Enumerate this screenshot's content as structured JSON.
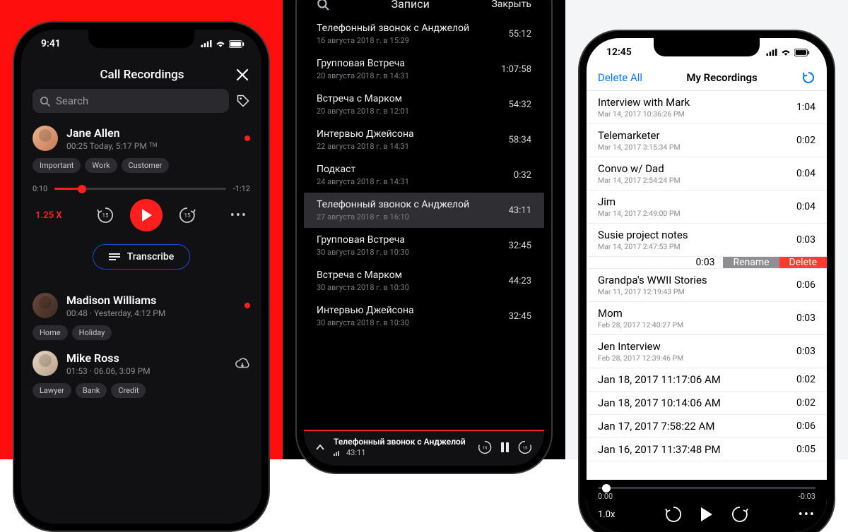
{
  "phone1": {
    "status_time": "9:41",
    "title": "Call Recordings",
    "search_placeholder": "Search",
    "slider": {
      "elapsed": "0:10",
      "remaining": "-1:12",
      "percent": 16
    },
    "speed": "1.25 X",
    "transcribe_label": "Transcribe",
    "items": [
      {
        "name": "Jane Allen",
        "meta": "00:25 Today, 5:17 PM ᵀᴹ",
        "tags": [
          "Important",
          "Work",
          "Customer"
        ],
        "unread": true
      },
      {
        "name": "Madison Williams",
        "meta": "00:48 · Yesterday, 4:12 PM",
        "tags": [
          "Home",
          "Holiday"
        ],
        "unread": true
      },
      {
        "name": "Mike Ross",
        "meta": "01:53 · 06.06, 3:09 PM",
        "tags": [
          "Lawyer",
          "Bank",
          "Credit"
        ],
        "unread": false,
        "cloud": true
      }
    ]
  },
  "phone2": {
    "header": {
      "title": "Записи",
      "close": "Закрыть"
    },
    "items": [
      {
        "name": "Телефонный звонок с Анджелой",
        "ts": "16 августа 2018 г. в 15:29",
        "dur": "55:12"
      },
      {
        "name": "Групповая Встреча",
        "ts": "20 августа 2018 г. в 14:31",
        "dur": "1:07:58"
      },
      {
        "name": "Встреча с Марком",
        "ts": "20 августа 2018 г. в 12:01",
        "dur": "54:32"
      },
      {
        "name": "Интервью Джейсона",
        "ts": "22 августа 2018 г. в 14:31",
        "dur": "58:34"
      },
      {
        "name": "Подкаст",
        "ts": "24 августа 2018 г. в 14:31",
        "dur": "0:32"
      },
      {
        "name": "Телефонный звонок с Анджелой",
        "ts": "27 августа 2018 г. в 16:10",
        "dur": "43:11",
        "selected": true
      },
      {
        "name": "Групповая Встреча",
        "ts": "30 августа 2018 г. в 10:30",
        "dur": "32:45"
      },
      {
        "name": "Встреча с Марком",
        "ts": "30 августа 2018 г. в 10:30",
        "dur": "44:23"
      },
      {
        "name": "Интервью Джейсона",
        "ts": "30 августа 2018 г. в 10:30",
        "dur": "32:45"
      }
    ],
    "now_playing": {
      "title": "Телефонный звонок с Анджелой",
      "time": "43:11"
    }
  },
  "phone3": {
    "status_time": "12:45",
    "nav": {
      "delete_all": "Delete All",
      "title": "My Recordings"
    },
    "swipe": {
      "rename": "Rename",
      "delete": "Delete",
      "dur": "0:03"
    },
    "player": {
      "elapsed": "0:00",
      "remaining": "-0:03",
      "speed": "1.0x"
    },
    "items": [
      {
        "name": "Interview with Mark",
        "ts": "Mar 14, 2017 10:36:26 PM",
        "dur": "1:04"
      },
      {
        "name": "Telemarketer",
        "ts": "Mar 14, 2017 3:15:34 PM",
        "dur": "0:02"
      },
      {
        "name": "Convo w/ Dad",
        "ts": "Mar 14, 2017 2:54:24 PM",
        "dur": "0:04"
      },
      {
        "name": "Jim",
        "ts": "Mar 14, 2017 2:49:00 PM",
        "dur": "0:04"
      },
      {
        "name": "Susie project notes",
        "ts": "Mar 14, 2017 2:47:53 PM",
        "dur": "0:03"
      },
      {
        "name": "Grandpa's WWII Stories",
        "ts": "Mar 11, 2017 12:19:43 PM",
        "dur": "0:06"
      },
      {
        "name": "Mom",
        "ts": "Feb 28, 2017 12:40:27 PM",
        "dur": "0:03"
      },
      {
        "name": "Jen Interview",
        "ts": "Feb 28, 2017 12:39:46 PM",
        "dur": "0:03"
      },
      {
        "name": "Jan 18, 2017 11:17:06 AM",
        "ts": "",
        "dur": "0:02"
      },
      {
        "name": "Jan 18, 2017 10:14:06 AM",
        "ts": "",
        "dur": "0:02"
      },
      {
        "name": "Jan 17, 2017 7:58:22 AM",
        "ts": "",
        "dur": "0:06"
      },
      {
        "name": "Jan 16, 2017 11:37:48 PM",
        "ts": "",
        "dur": "0:05"
      }
    ]
  }
}
